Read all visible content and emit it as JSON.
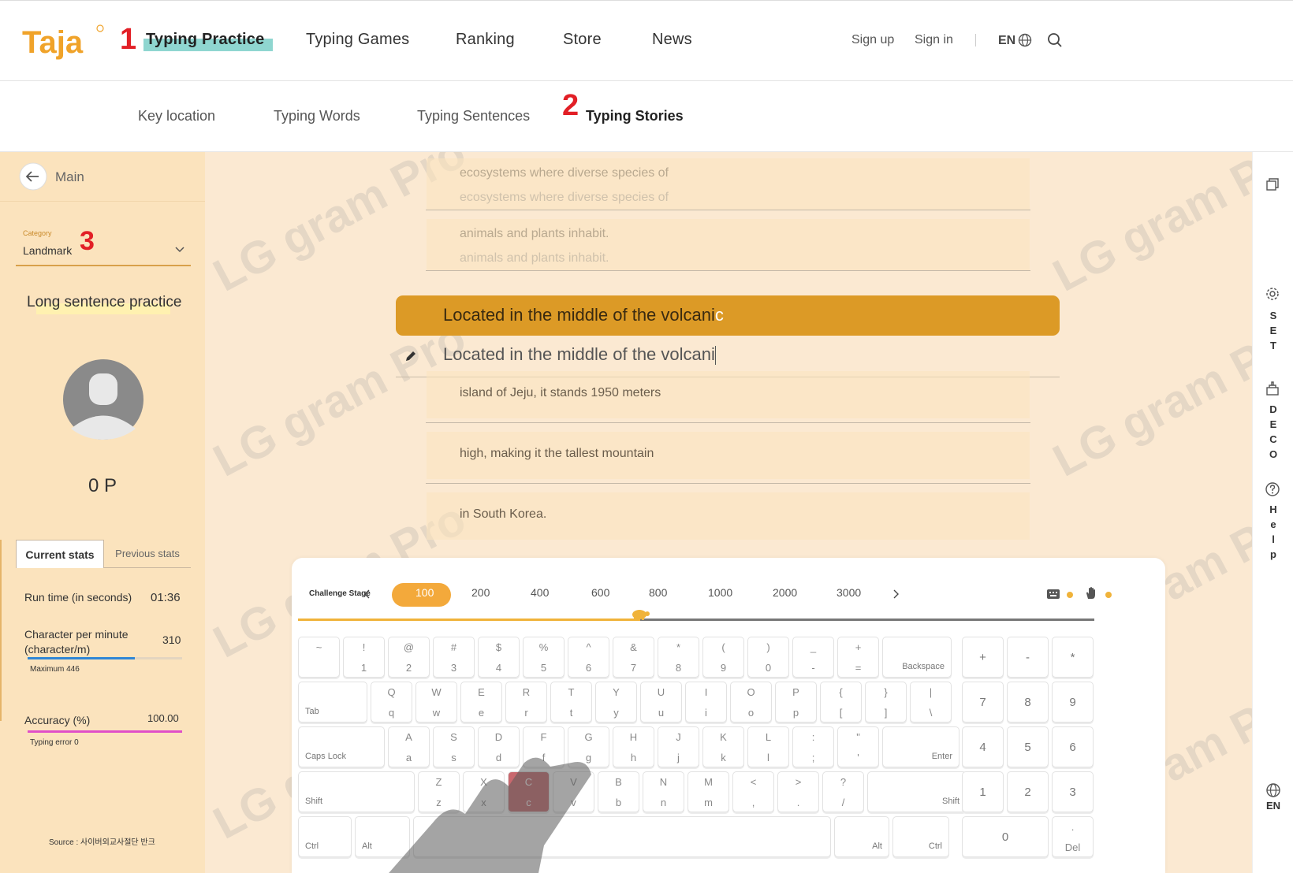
{
  "header": {
    "logo_text": "Taja",
    "markers": [
      "1",
      "2",
      "3"
    ],
    "nav": [
      "Typing Practice",
      "Typing Games",
      "Ranking",
      "Store",
      "News"
    ],
    "sign_up": "Sign up",
    "sign_in": "Sign in",
    "lang": "EN"
  },
  "subnav": [
    "Key location",
    "Typing Words",
    "Typing Sentences",
    "Typing Stories"
  ],
  "sidebar": {
    "back_label": "Main",
    "category_label": "Category",
    "category_value": "Landmark",
    "title": "Long sentence practice",
    "points": "0 P",
    "tabs": [
      "Current stats",
      "Previous stats"
    ],
    "run_time_label": "Run time (in seconds)",
    "run_time_value": "01:36",
    "cpm_label": "Character per minute (character/m)",
    "cpm_value": "310",
    "cpm_progress": 0.695,
    "cpm_max": "Maximum 446",
    "accuracy_label": "Accuracy (%)",
    "accuracy_value": "100.00",
    "accuracy_progress": 1.0,
    "typing_error": "Typing error 0",
    "source": "Source : 사이버외교사절단 반크"
  },
  "watermark": "LG gram Pro",
  "practice": {
    "done_lines": [
      "ecosystems where diverse species of",
      "animals and plants inhabit."
    ],
    "current_typed": "Located in the middle of the volcani",
    "current_next": "c",
    "typed_input": "Located in the middle of the volcani",
    "upcoming": [
      "island of Jeju, it stands 1950 meters",
      "high, making it the tallest mountain",
      "in South Korea."
    ]
  },
  "challenge": {
    "label": "Challenge Stage",
    "stages": [
      "100",
      "200",
      "400",
      "600",
      "800",
      "1000",
      "2000",
      "3000"
    ],
    "active": "100",
    "progress": 0.43
  },
  "keyboard": {
    "row1": [
      [
        "~",
        ""
      ],
      [
        "!",
        "1"
      ],
      [
        "@",
        "2"
      ],
      [
        "#",
        "3"
      ],
      [
        "$",
        "4"
      ],
      [
        "%",
        "5"
      ],
      [
        "^",
        "6"
      ],
      [
        "&",
        "7"
      ],
      [
        "*",
        "8"
      ],
      [
        "(",
        "9"
      ],
      [
        ")",
        "0"
      ],
      [
        "_",
        "-"
      ],
      [
        "+",
        "="
      ]
    ],
    "row2": [
      [
        "Q",
        "q"
      ],
      [
        "W",
        "w"
      ],
      [
        "E",
        "e"
      ],
      [
        "R",
        "r"
      ],
      [
        "T",
        "t"
      ],
      [
        "Y",
        "y"
      ],
      [
        "U",
        "u"
      ],
      [
        "I",
        "i"
      ],
      [
        "O",
        "o"
      ],
      [
        "P",
        "p"
      ],
      [
        "{",
        "["
      ],
      [
        "}",
        "]"
      ],
      [
        "|",
        "\\"
      ]
    ],
    "row3": [
      [
        "A",
        "a"
      ],
      [
        "S",
        "s"
      ],
      [
        "D",
        "d"
      ],
      [
        "F",
        "f"
      ],
      [
        "G",
        "g"
      ],
      [
        "H",
        "h"
      ],
      [
        "J",
        "j"
      ],
      [
        "K",
        "k"
      ],
      [
        "L",
        "l"
      ],
      [
        ":",
        ";"
      ],
      [
        "\"",
        "'"
      ]
    ],
    "row4": [
      [
        "Z",
        "z"
      ],
      [
        "X",
        "x"
      ],
      [
        "C",
        "c"
      ],
      [
        "V",
        "v"
      ],
      [
        "B",
        "b"
      ],
      [
        "N",
        "n"
      ],
      [
        "M",
        "m"
      ],
      [
        "<",
        ","
      ],
      [
        ">",
        "."
      ],
      [
        "?",
        "/"
      ]
    ],
    "backspace": "Backspace",
    "tab": "Tab",
    "caps": "Caps Lock",
    "enter": "Enter",
    "shift": "Shift",
    "ctrl": "Ctrl",
    "alt": "Alt",
    "numpad_top": [
      "+",
      "-",
      "*"
    ],
    "numpad": [
      [
        "7",
        "8",
        "9"
      ],
      [
        "4",
        "5",
        "6"
      ],
      [
        "1",
        "2",
        "3"
      ]
    ],
    "num0": "0",
    "del_top": ".",
    "del": "Del",
    "highlight_key": "c",
    "highlight_color": "#c9686e"
  },
  "rightbar": {
    "set": "SET",
    "deco": "DECO",
    "help": "Help",
    "lang": "EN"
  },
  "colors": {
    "accent": "#dc9a26",
    "panel": "#fbe3bd",
    "stage_bg": "#fbe9d2",
    "marker": "#e21f26"
  }
}
